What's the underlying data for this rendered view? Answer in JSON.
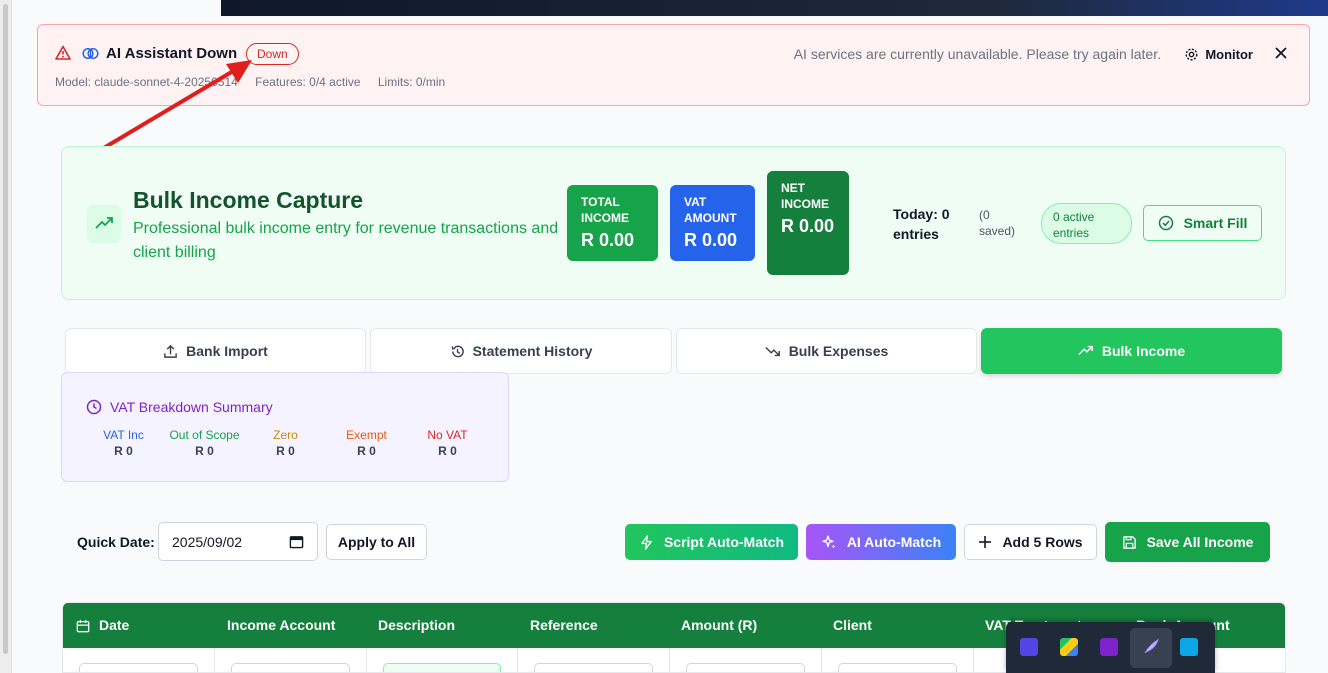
{
  "alert": {
    "title": "AI Assistant Down",
    "status_badge": "Down",
    "model": "Model: claude-sonnet-4-20250514",
    "features": "Features: 0/4 active",
    "limits": "Limits: 0/min",
    "message": "AI services are currently unavailable. Please try again later.",
    "monitor_label": "Monitor"
  },
  "hero": {
    "title": "Bulk Income Capture",
    "subtitle": "Professional bulk income entry for revenue transactions and client billing",
    "total_income_label": "TOTAL INCOME",
    "total_income_value": "R 0.00",
    "vat_amount_label": "VAT AMOUNT",
    "vat_amount_value": "R 0.00",
    "net_income_label": "NET INCOME",
    "net_income_value": "R 0.00",
    "today": "Today: 0 entries",
    "saved": "(0 saved)",
    "active_entries": "0 active entries",
    "smart_fill_label": "Smart Fill"
  },
  "tabs": [
    {
      "label": "Bank Import",
      "icon": "upload-icon"
    },
    {
      "label": "Statement History",
      "icon": "history-icon"
    },
    {
      "label": "Bulk Expenses",
      "icon": "trending-down-icon"
    },
    {
      "label": "Bulk Income",
      "icon": "trending-up-icon",
      "active": true
    }
  ],
  "vat_summary": {
    "title": "VAT Breakdown Summary",
    "items": [
      {
        "label": "VAT Inc",
        "value": "R 0",
        "color": "#2563eb"
      },
      {
        "label": "Out of Scope",
        "value": "R 0",
        "color": "#16a34a"
      },
      {
        "label": "Zero",
        "value": "R 0",
        "color": "#ca8a04"
      },
      {
        "label": "Exempt",
        "value": "R 0",
        "color": "#ea580c"
      },
      {
        "label": "No VAT",
        "value": "R 0",
        "color": "#dc2626"
      }
    ]
  },
  "toolbar": {
    "quick_date_label": "Quick Date:",
    "quick_date_value": "2025/09/02",
    "apply_label": "Apply to All",
    "script_label": "Script Auto-Match",
    "ai_label": "AI Auto-Match",
    "add_rows_label": "Add 5 Rows",
    "save_label": "Save All Income"
  },
  "table": {
    "headers": [
      "Date",
      "Income Account",
      "Description",
      "Reference",
      "Amount (R)",
      "Client",
      "VAT Treatment",
      "Bank Account"
    ]
  },
  "colors": {
    "primary_green": "#16a34a",
    "alert_red": "#dc2626",
    "vat_blue": "#2563eb",
    "purple": "#7e22ce"
  }
}
